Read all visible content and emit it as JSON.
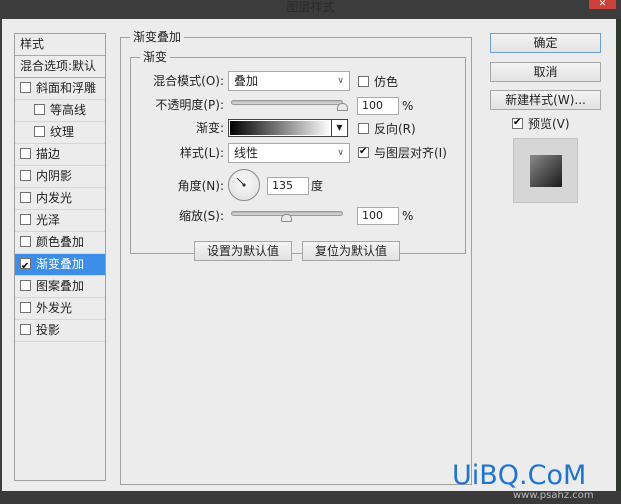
{
  "window": {
    "title": "图层样式",
    "close_glyph": "✕"
  },
  "styles_list": {
    "header": "样式",
    "blend_options": "混合选项:默认",
    "items": [
      {
        "label": "斜面和浮雕",
        "checked": false,
        "indent": false
      },
      {
        "label": "等高线",
        "checked": false,
        "indent": true
      },
      {
        "label": "纹理",
        "checked": false,
        "indent": true
      },
      {
        "label": "描边",
        "checked": false,
        "indent": false
      },
      {
        "label": "内阴影",
        "checked": false,
        "indent": false
      },
      {
        "label": "内发光",
        "checked": false,
        "indent": false
      },
      {
        "label": "光泽",
        "checked": false,
        "indent": false
      },
      {
        "label": "颜色叠加",
        "checked": false,
        "indent": false
      },
      {
        "label": "渐变叠加",
        "checked": true,
        "indent": false,
        "selected": true
      },
      {
        "label": "图案叠加",
        "checked": false,
        "indent": false
      },
      {
        "label": "外发光",
        "checked": false,
        "indent": false
      },
      {
        "label": "投影",
        "checked": false,
        "indent": false
      }
    ]
  },
  "panel": {
    "group_title": "渐变叠加",
    "subgroup_title": "渐变",
    "blend_mode": {
      "label": "混合模式(O):",
      "value": "叠加"
    },
    "dither": {
      "label": "仿色",
      "checked": false
    },
    "opacity": {
      "label": "不透明度(P):",
      "value": "100",
      "unit": "%",
      "percent": 100
    },
    "gradient": {
      "label": "渐变:",
      "from": "#000000",
      "to": "#ffffff"
    },
    "reverse": {
      "label": "反向(R)",
      "checked": false
    },
    "style": {
      "label": "样式(L):",
      "value": "线性"
    },
    "align_with_layer": {
      "label": "与图层对齐(I)",
      "checked": true
    },
    "angle": {
      "label": "角度(N):",
      "value": "135",
      "unit": "度",
      "degrees": 135
    },
    "scale": {
      "label": "缩放(S):",
      "value": "100",
      "unit": "%",
      "percent": 100
    },
    "make_default": "设置为默认值",
    "reset_default": "复位为默认值"
  },
  "actions": {
    "ok": "确定",
    "cancel": "取消",
    "new_style": "新建样式(W)...",
    "preview": {
      "label": "预览(V)",
      "checked": true
    }
  },
  "watermark": {
    "main": "UiBQ.CoM",
    "sub": "www.psahz.com"
  }
}
